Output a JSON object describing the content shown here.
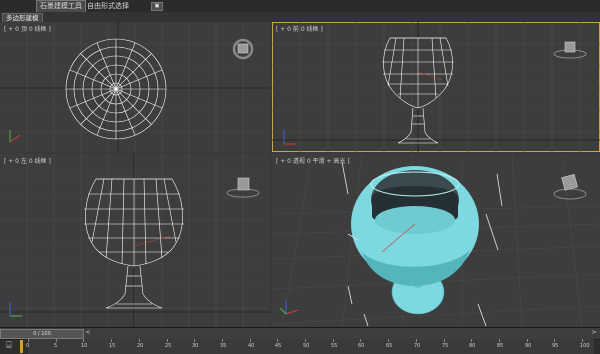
{
  "ribbon": {
    "tabs": [
      "石墨建模工具",
      "自由形式",
      "选择"
    ],
    "toggle_label": "▣"
  },
  "subbar": {
    "panel_label": "多边形建模"
  },
  "viewports": {
    "top": "[ + 0 顶 0 线框 ]",
    "front": "[ + 0 前 0 线框 ]",
    "left": "[ + 0 左 0 线框 ]",
    "perspective": "[ + 0 透视 0 平滑 + 高光 ]"
  },
  "timeline": {
    "slider_label": "0 / 100",
    "prev": "<",
    "next": ">",
    "ticks": [
      "0",
      "5",
      "10",
      "15",
      "20",
      "25",
      "30",
      "35",
      "40",
      "45",
      "50",
      "55",
      "60",
      "65",
      "70",
      "75",
      "80",
      "85",
      "90",
      "95",
      "100"
    ]
  },
  "colors": {
    "active_viewport": "#c8a64a",
    "model_fill": "#7ed8df",
    "wire": "#ffffff",
    "grid": "#555555"
  }
}
